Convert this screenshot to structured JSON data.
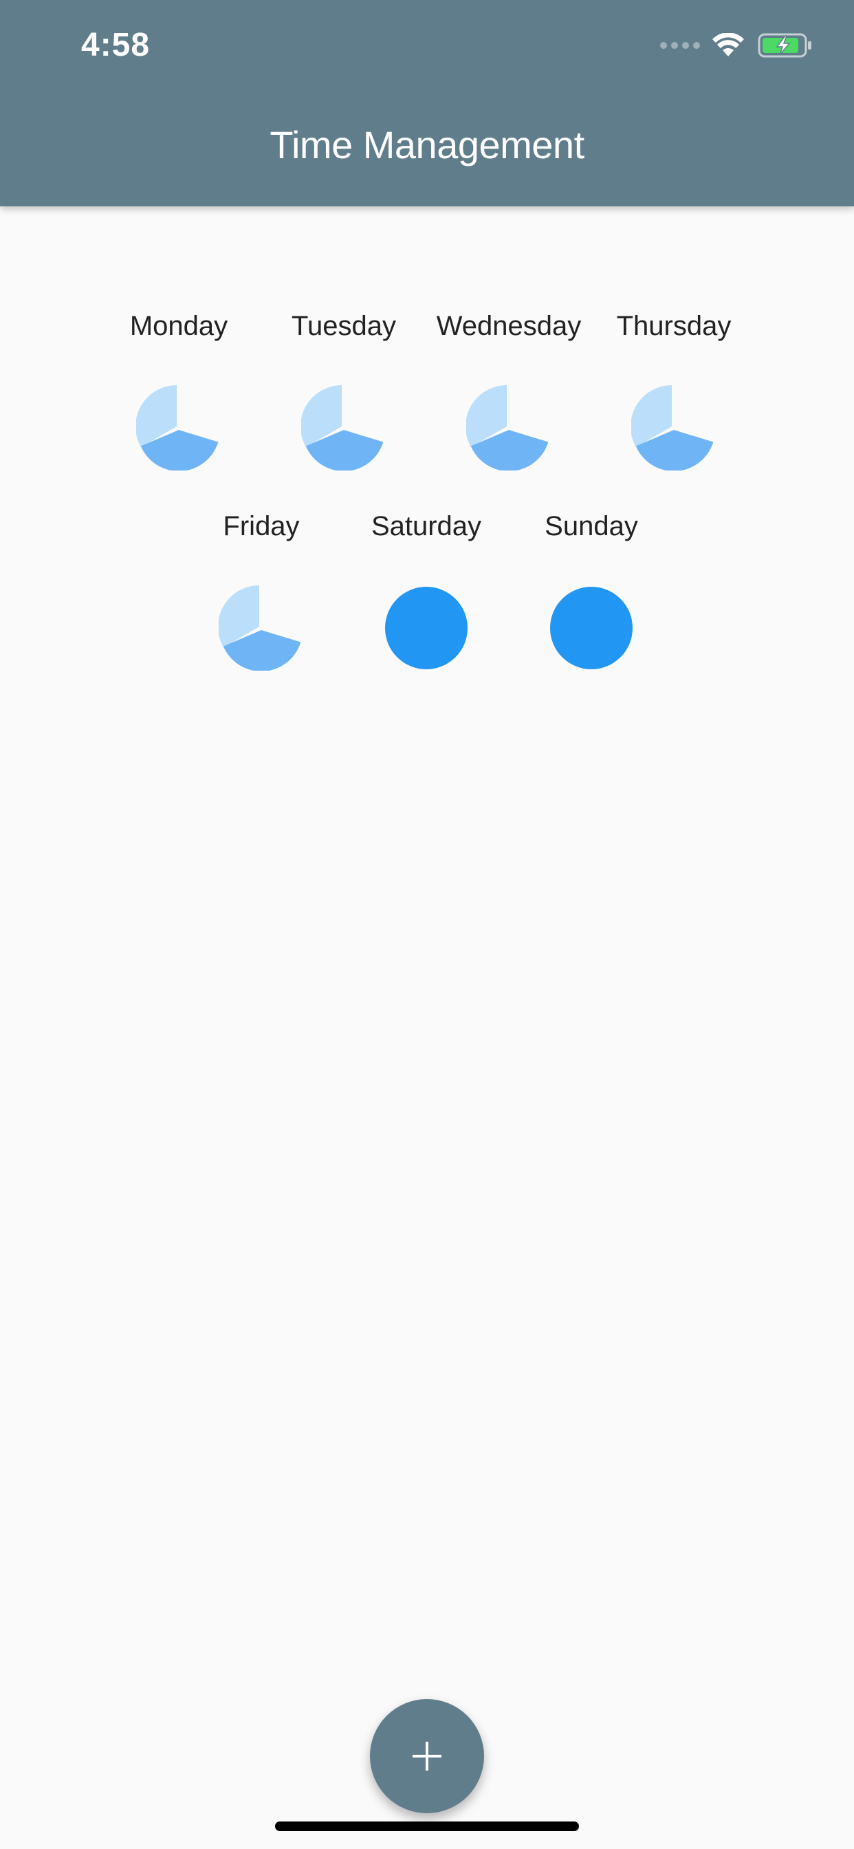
{
  "status_bar": {
    "time": "4:58"
  },
  "app_bar": {
    "title": "Time Management"
  },
  "colors": {
    "app_bar": "#607d8b",
    "pie_light": "#bbdefb",
    "pie_medium": "#6fb5f5",
    "pie_full": "#2196f3",
    "fab": "#607d8b",
    "battery_fill": "#4cd964"
  },
  "days": [
    {
      "label": "Monday",
      "slices": [
        0.3333,
        0.3333,
        0.3334
      ],
      "type": "split"
    },
    {
      "label": "Tuesday",
      "slices": [
        0.3333,
        0.3333,
        0.3334
      ],
      "type": "split"
    },
    {
      "label": "Wednesday",
      "slices": [
        0.3333,
        0.3333,
        0.3334
      ],
      "type": "split"
    },
    {
      "label": "Thursday",
      "slices": [
        0.3333,
        0.3333,
        0.3334
      ],
      "type": "split"
    },
    {
      "label": "Friday",
      "slices": [
        0.3333,
        0.3333,
        0.3334
      ],
      "type": "split"
    },
    {
      "label": "Saturday",
      "slices": [
        1
      ],
      "type": "full"
    },
    {
      "label": "Sunday",
      "slices": [
        1
      ],
      "type": "full"
    }
  ],
  "fab": {
    "icon": "plus-icon"
  }
}
